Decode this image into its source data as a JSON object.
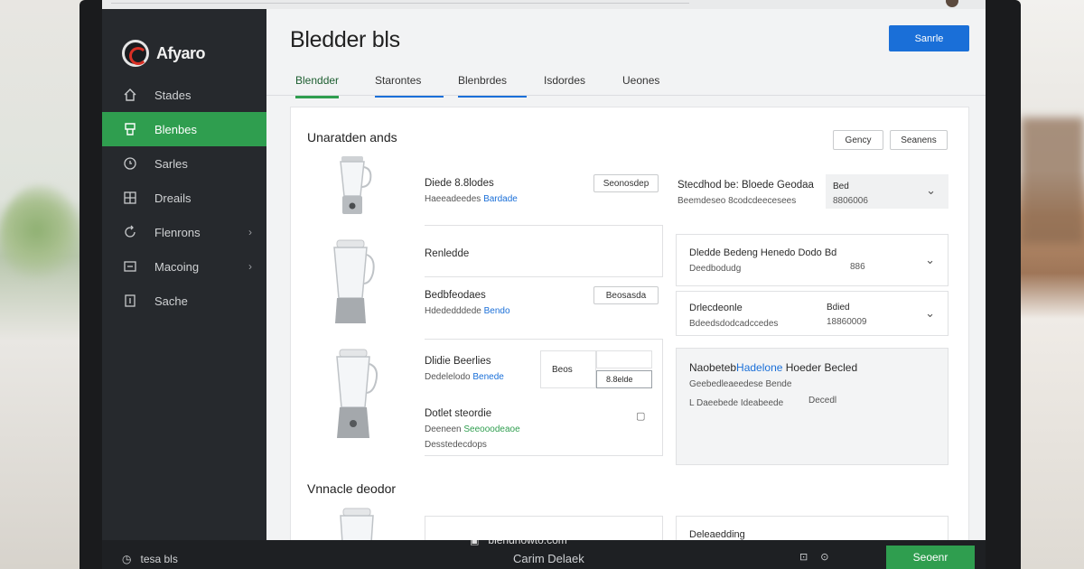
{
  "app": {
    "brand": "Afyaro",
    "window_title": "Bledder bls"
  },
  "sidebar": {
    "items": [
      {
        "label": "Stades",
        "icon": "house-icon"
      },
      {
        "label": "Blenbes",
        "icon": "blender-icon",
        "active": true
      },
      {
        "label": "Sarles",
        "icon": "clock-icon"
      },
      {
        "label": "Dreails",
        "icon": "grid-icon"
      },
      {
        "label": "Flenrons",
        "icon": "refresh-icon",
        "chevron": true
      },
      {
        "label": "Macoing",
        "icon": "square-icon",
        "chevron": true
      },
      {
        "label": "Sache",
        "icon": "doc-icon"
      }
    ]
  },
  "header": {
    "primary_button": "Sanrle"
  },
  "tabs": [
    {
      "label": "Blendder",
      "active": true
    },
    {
      "label": "Starontes"
    },
    {
      "label": "Blenbrdes"
    },
    {
      "label": "Isdordes"
    },
    {
      "label": "Ueones"
    }
  ],
  "section1": {
    "title": "Unaratden ands",
    "btn_a": "Gency",
    "btn_b": "Seanens",
    "rows": [
      {
        "title": "Diede 8.8lodes",
        "sub_plain": "Haeeadeedes ",
        "sub_link": "Bardade",
        "button": "Seonosdep"
      },
      {
        "title": "Renledde",
        "sub_plain": "",
        "sub_link": ""
      },
      {
        "title": "Bedbfeodaes",
        "sub_plain": "Hdededddede ",
        "sub_link": "Bendo",
        "button": "Beosasda"
      },
      {
        "title": "Dlidie Beerlies",
        "sub_plain": "Dedelelodo ",
        "sub_link": "Benede",
        "qty": "Beos",
        "qty2": "8.8elde"
      }
    ],
    "extra": {
      "title": "Dotlet steordie",
      "sub_plain": "Deeneen ",
      "sub_link": "Seeooodeaoe",
      "sub2": "Desstedecdops"
    },
    "specs": [
      {
        "title": "Stecdhod be: Bloede Geodaa",
        "sub": "Beemdeseo 8codcdeecesees",
        "val_a": "Bed",
        "val_b": "8806006"
      },
      {
        "title": "Dledde Bedeng Henedo Dodo Bd",
        "sub": "Deedbodudg",
        "val_b": "886"
      },
      {
        "title": "Drlecdeonle",
        "sub": "Bdeedsdodcadccedes",
        "val_a": "Bdied",
        "val_b": "18860009"
      },
      {
        "title_plain": "Naobeteb",
        "title_link": "Hadelone",
        "title_rest": " Hoeder Becled",
        "sub": "Geebedleaeedese Bende",
        "sub2": "L Daeebede  Ideabeede",
        "val_b": "Decedl"
      }
    ]
  },
  "section2": {
    "title": "Vnnacle deodor",
    "spec_title": "Deleaedding"
  },
  "bottombar": {
    "left_label": "tesa bls",
    "center_label": "Carim Delaek",
    "button": "Seoenr"
  },
  "watermark": "blendhowto.com",
  "colors": {
    "accent_green": "#2f9e4f",
    "accent_blue": "#1a6fd8",
    "sidebar_bg": "#26292d"
  }
}
